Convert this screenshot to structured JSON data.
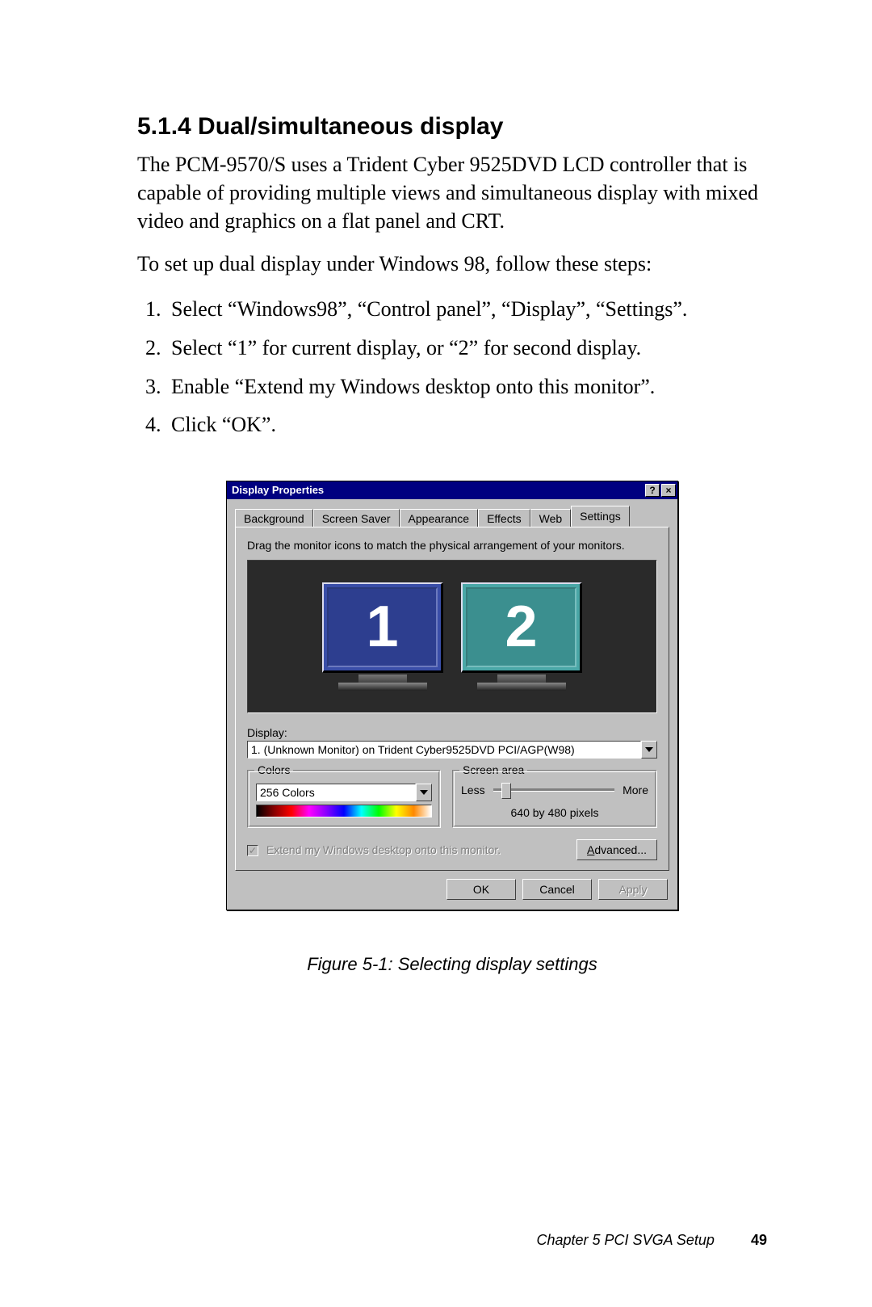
{
  "section": {
    "number": "5.1.4",
    "title": "5.1.4 Dual/simultaneous display",
    "para1": "The PCM-9570/S uses a Trident Cyber 9525DVD LCD controller that is capable of providing multiple views and simultaneous display with mixed video and graphics on a flat panel and CRT.",
    "para2": "To set up dual display under Windows 98, follow these steps:",
    "steps": [
      "Select “Windows98”, “Control panel”, “Display”, “Settings”.",
      "Select “1” for current display, or “2” for second display.",
      "Enable “Extend my Windows desktop onto this monitor”.",
      "Click “OK”."
    ]
  },
  "dialog": {
    "title": "Display Properties",
    "help_btn": "?",
    "close_btn": "×",
    "tabs": [
      "Background",
      "Screen Saver",
      "Appearance",
      "Effects",
      "Web",
      "Settings"
    ],
    "active_tab_index": 5,
    "instruction": "Drag the monitor icons to match the physical arrangement of your monitors.",
    "monitors": {
      "m1": "1",
      "m2": "2"
    },
    "display_label": "Display:",
    "display_value": "1. (Unknown Monitor) on Trident Cyber9525DVD PCI/AGP(W98)",
    "colors": {
      "legend": "Colors",
      "value": "256 Colors"
    },
    "screen_area": {
      "legend": "Screen area",
      "less": "Less",
      "more": "More",
      "resolution": "640 by 480 pixels"
    },
    "extend_checkbox": "Extend my Windows desktop onto this monitor.",
    "advanced_btn": "Advanced...",
    "ok_btn": "OK",
    "cancel_btn": "Cancel",
    "apply_btn": "Apply"
  },
  "figure_caption": "Figure 5-1: Selecting display settings",
  "footer": {
    "chapter": "Chapter 5  PCI SVGA Setup",
    "page": "49"
  }
}
